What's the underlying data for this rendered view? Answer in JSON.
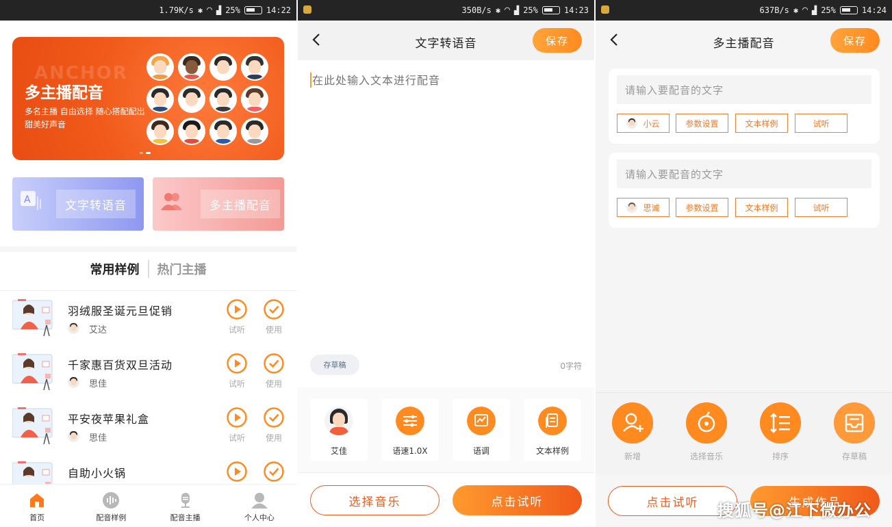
{
  "panel1": {
    "status": {
      "speed": "1.79K/s",
      "battery": "25%",
      "time": "14:22"
    },
    "banner": {
      "ghost_text": "ANCHOR",
      "title": "多主播配音",
      "desc": "多名主播  自由选择  随心搭配配出甜美好声音"
    },
    "quick": {
      "tts": "文字转语音",
      "multi": "多主播配音"
    },
    "tabs": {
      "common": "常用样例",
      "hot": "热门主播"
    },
    "rows": [
      {
        "title": "羽绒服圣诞元旦促销",
        "voice": "艾达",
        "play": "试听",
        "use": "使用"
      },
      {
        "title": "千家惠百货双旦活动",
        "voice": "思佳",
        "play": "试听",
        "use": "使用"
      },
      {
        "title": "平安夜苹果礼盒",
        "voice": "思佳",
        "play": "试听",
        "use": "使用"
      },
      {
        "title": "自助小火锅",
        "voice": "",
        "play": "试听",
        "use": "使用"
      }
    ],
    "nav": [
      {
        "label": "首页",
        "icon": "home-icon"
      },
      {
        "label": "配音样例",
        "icon": "waveform-icon"
      },
      {
        "label": "配音主播",
        "icon": "microphone-icon"
      },
      {
        "label": "个人中心",
        "icon": "user-icon"
      }
    ],
    "colors": {
      "accent": "#f05a1a",
      "orange": "#ff8a1f"
    }
  },
  "panel2": {
    "status": {
      "speed": "350B/s",
      "battery": "25%",
      "time": "14:23"
    },
    "title": "文字转语音",
    "save": "保存",
    "placeholder": "在此处输入文本进行配音",
    "draft": "存草稿",
    "char_count": "0字符",
    "tools": [
      {
        "label": "艾佳",
        "icon": "avatar-icon"
      },
      {
        "label": "语速1.0X",
        "icon": "sliders-icon"
      },
      {
        "label": "语调",
        "icon": "pitch-chart-icon"
      },
      {
        "label": "文本样例",
        "icon": "document-icon"
      }
    ],
    "choose_music": "选择音乐",
    "preview": "点击试听"
  },
  "panel3": {
    "status": {
      "speed": "637B/s",
      "battery": "25%",
      "time": "14:24"
    },
    "title": "多主播配音",
    "save": "保存",
    "cards": [
      {
        "placeholder": "请输入要配音的文字",
        "voice": "小云",
        "params": "参数设置",
        "sample": "文本样例",
        "listen": "试听"
      },
      {
        "placeholder": "请输入要配音的文字",
        "voice": "思诚",
        "params": "参数设置",
        "sample": "文本样例",
        "listen": "试听"
      }
    ],
    "actions": [
      {
        "label": "新增",
        "icon": "add-user-icon"
      },
      {
        "label": "选择音乐",
        "icon": "music-disc-icon"
      },
      {
        "label": "排序",
        "icon": "sort-icon"
      },
      {
        "label": "存草稿",
        "icon": "inbox-icon"
      }
    ],
    "preview": "点击试听",
    "generate": "生成作品",
    "watermark": "搜狐号@江下微办公"
  }
}
